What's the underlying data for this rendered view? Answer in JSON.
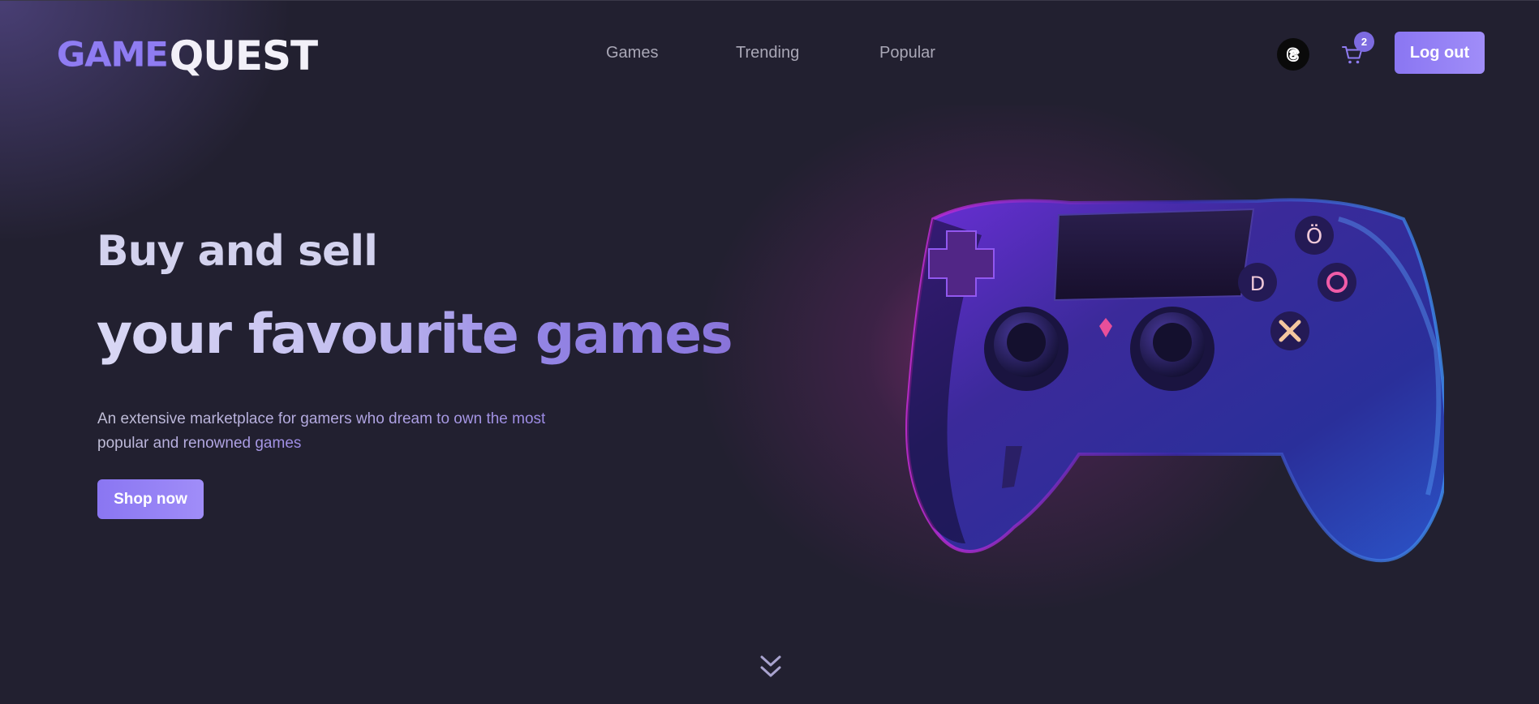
{
  "brand": {
    "logo_part1": "GAME",
    "logo_part2": "QUEST"
  },
  "nav": {
    "items": [
      {
        "label": "Games"
      },
      {
        "label": "Trending"
      },
      {
        "label": "Popular"
      }
    ]
  },
  "header": {
    "threads_icon": "threads-icon",
    "cart_icon": "cart-icon",
    "cart_count": "2",
    "logout_label": "Log out"
  },
  "hero": {
    "title_line1": "Buy and sell",
    "title_line2": "your favourite games",
    "description_line1": "An extensive marketplace for gamers who dream to own the most",
    "description_line2": "popular and renowned games",
    "cta_label": "Shop now",
    "image": "game-controller-image",
    "scroll_icon": "double-chevron-down-icon"
  },
  "colors": {
    "background": "#222030",
    "accent": "#8f7cf2",
    "button": "#9583f5",
    "nav_text": "#a9a7b6",
    "glow": "#be3296"
  }
}
